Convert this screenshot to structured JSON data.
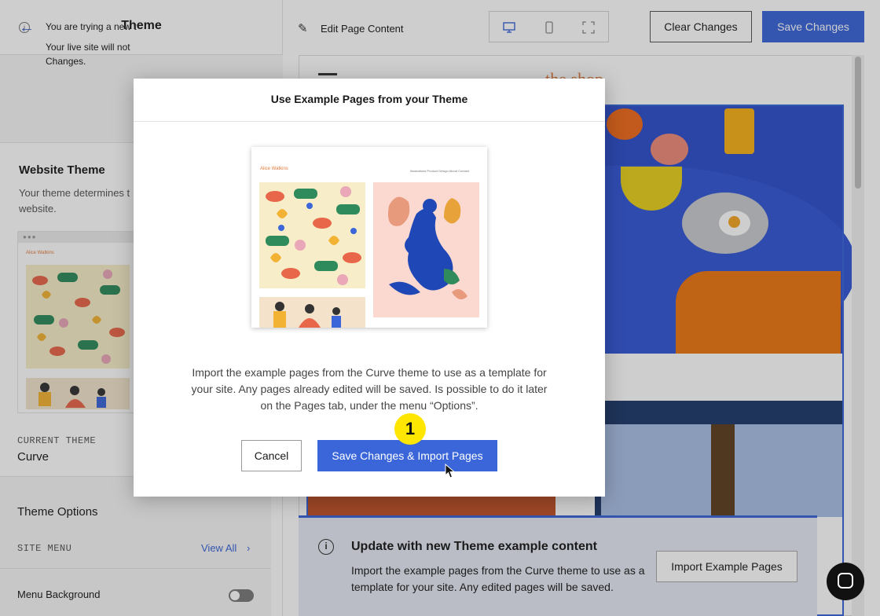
{
  "sidebar": {
    "back_icon": "arrow-left-icon",
    "title": "Theme",
    "notice": {
      "icon": "info-icon",
      "line1": "You are trying a new t",
      "line2": "Your live site will not",
      "line3": "Changes."
    },
    "website_theme": {
      "title": "Website Theme",
      "desc_line1": "Your theme determines t",
      "desc_line2": "website."
    },
    "thumbnail": {
      "site_name": "Alice Watkins"
    },
    "current_theme_label": "CURRENT THEME",
    "current_theme_name": "Curve",
    "theme_options": {
      "title": "Theme Options",
      "site_menu_label": "SITE MENU",
      "view_all": "View All",
      "menu_background_label": "Menu Background"
    }
  },
  "toolbar": {
    "edit_label": "Edit Page Content",
    "clear_label": "Clear Changes",
    "save_label": "Save Changes",
    "devices": [
      "desktop-icon",
      "mobile-icon",
      "fullscreen-icon"
    ]
  },
  "preview": {
    "site_logo": "the shop"
  },
  "banner": {
    "title": "Update with new Theme example content",
    "line1": "Import the example pages from the Curve theme to use as a",
    "line2": "template for your site. Any edited pages will be saved.",
    "button": "Import Example Pages"
  },
  "modal": {
    "title": "Use Example Pages from your Theme",
    "preview": {
      "site_name": "Alice Watkins",
      "nav": "Illustrations   Product Design   About   Contact"
    },
    "text_line1": "Import the example pages from the Curve theme to use as a template for",
    "text_line2": "your site. Any pages already edited will be saved. Is possible to do it later",
    "text_line3": "on the Pages tab, under the menu “Options”.",
    "cancel_label": "Cancel",
    "import_label": "Save Changes & Import Pages"
  },
  "step_marker": "1",
  "colors": {
    "accent": "#3a66d9",
    "marker": "#ffe600"
  }
}
